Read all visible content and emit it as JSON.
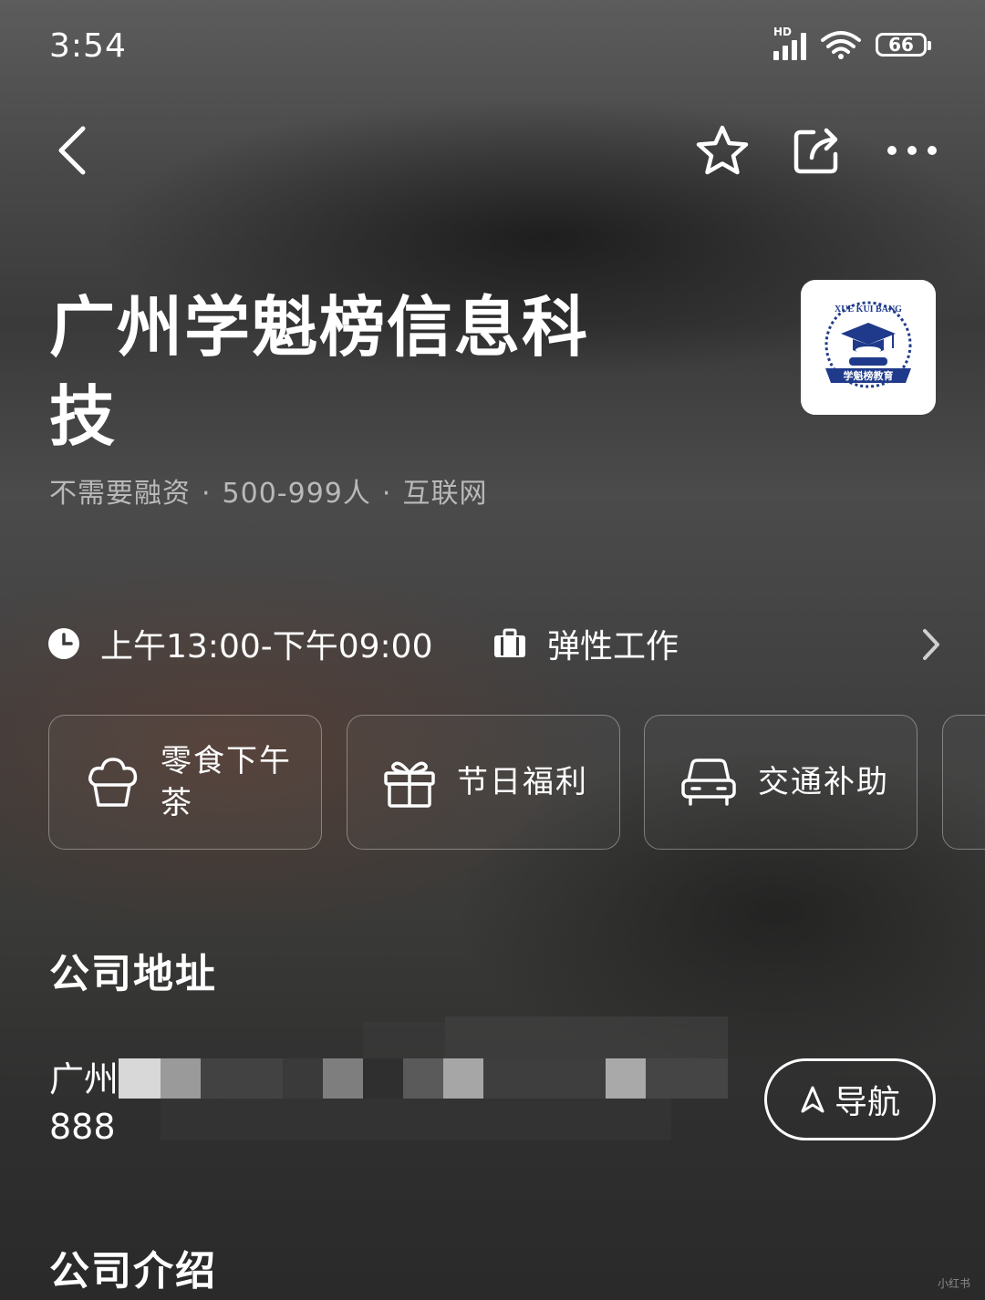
{
  "status_bar": {
    "time": "3:54",
    "network_label": "HD",
    "battery": "66"
  },
  "icons": {
    "back": "chevron-left-icon",
    "favorite": "star-icon",
    "share": "share-icon",
    "more": "more-horizontal-icon"
  },
  "company": {
    "name": "广州学魁榜信息科技",
    "funding": "不需要融资",
    "size": "500-999人",
    "industry": "互联网",
    "separator": "·",
    "logo_text_top": "XUE KUI BANG",
    "logo_text_banner": "学魁榜教育"
  },
  "work_info": {
    "hours": "上午13:00-下午09:00",
    "work_type": "弹性工作"
  },
  "benefits": [
    {
      "label": "零食下午茶",
      "icon": "cake-icon"
    },
    {
      "label": "节日福利",
      "icon": "gift-icon"
    },
    {
      "label": "交通补助",
      "icon": "car-icon"
    }
  ],
  "address_section": {
    "title": "公司地址",
    "address_line1": "广州",
    "address_line2": "888",
    "navigate_label": "导航"
  },
  "intro_section": {
    "title": "公司介绍"
  },
  "watermark": "小红书",
  "colors": {
    "text_primary": "#ffffff",
    "text_secondary": "#b9b9b9",
    "logo_blue": "#1f3a8a"
  }
}
